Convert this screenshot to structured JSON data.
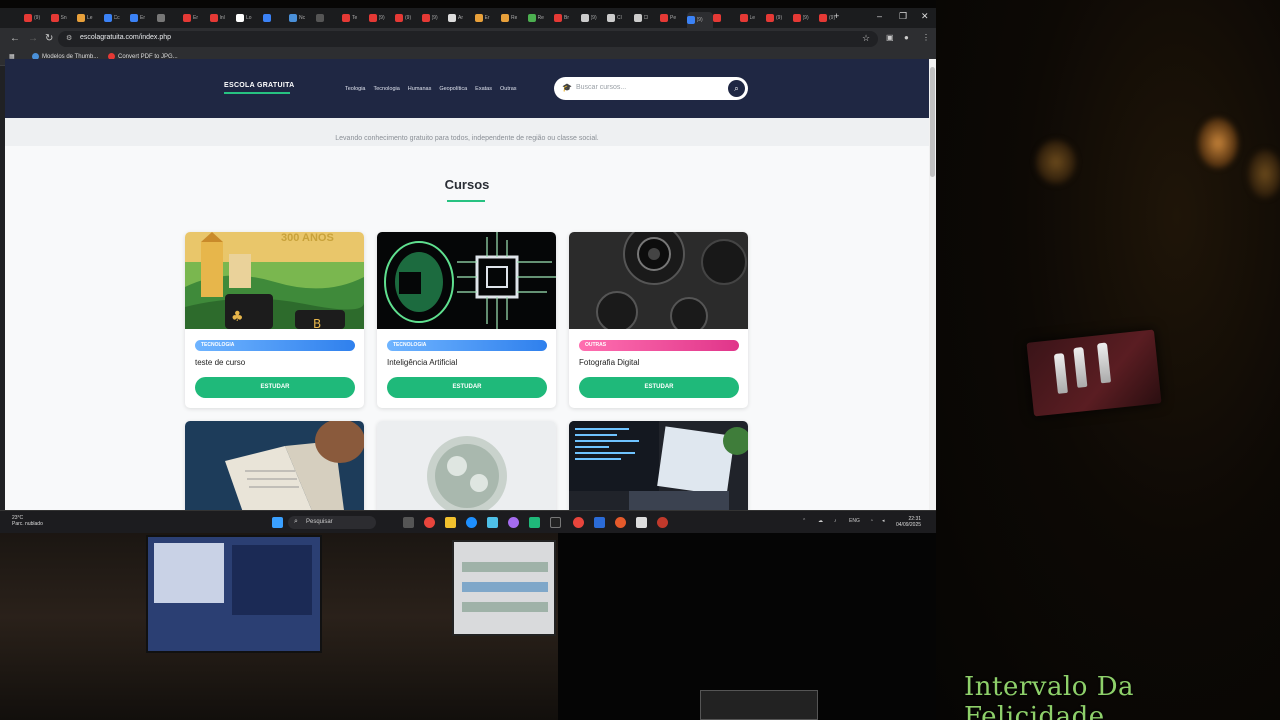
{
  "browser": {
    "tabs": [
      "(9)",
      "Sn",
      "Le",
      "Cc",
      "Er",
      "",
      "Er",
      "Inl",
      "Lo",
      "",
      "Nc",
      "",
      "Te",
      "(9)",
      "(9)",
      "(9)",
      "Ar",
      "Er",
      "Re",
      "Re",
      "Br",
      "(9)",
      "Cl",
      "Cl",
      "Pe",
      "(9)",
      "",
      "Le",
      "(9)",
      "(9)",
      "(9)"
    ],
    "url": "escolagratuita.com/index.php",
    "bookmarks": [
      "Modelos de Thumb...",
      "Convert PDF to JPG..."
    ]
  },
  "site": {
    "logo": "ESCOLA GRATUITA",
    "nav": [
      "Teologia",
      "Tecnologia",
      "Humanas",
      "Geopolítica",
      "Exatas",
      "Outras"
    ],
    "search_placeholder": "Buscar cursos...",
    "tagline": "Levando conhecimento gratuito para todos, independente de região ou classe social.",
    "section_title": "Cursos",
    "cards": [
      {
        "category": "TECNOLOGIA",
        "title": "teste de curso",
        "cta": "ESTUDAR",
        "badge_color": "#3d8ef0",
        "image_caption": "300 ANOS"
      },
      {
        "category": "TECNOLOGIA",
        "title": "Inteligência Artificial",
        "cta": "ESTUDAR",
        "badge_color": "#3d8ef0"
      },
      {
        "category": "OUTRAS",
        "title": "Fotografia Digital",
        "cta": "ESTUDAR",
        "badge_color": "#e8479b"
      }
    ]
  },
  "taskbar": {
    "weather_temp": "23°C",
    "weather_desc": "Parc. nublado",
    "search_label": "Pesquisar",
    "lang": "ENG",
    "time": "22:31",
    "date": "04/09/2025"
  },
  "overlay": {
    "watermark": "Intervalo Da Felicidade"
  }
}
